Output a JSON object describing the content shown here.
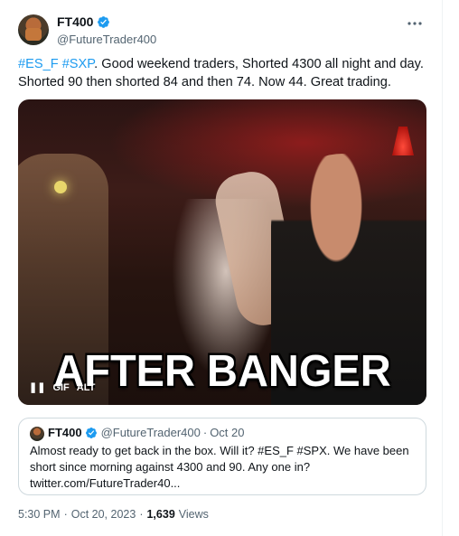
{
  "author": {
    "display_name": "FT400",
    "handle": "@FutureTrader400",
    "verified_icon": "verified-badge-icon"
  },
  "more_icon": "more-horizontal-icon",
  "tweet": {
    "hashtag_1": "#ES_F",
    "hashtag_2": "#SXP",
    "text_rest": ". Good weekend traders, Shorted 4300 all night and day. Shorted 90 then shorted 84 and then 74.  Now 44. Great trading."
  },
  "media": {
    "caption": "AFTER BANGER",
    "pause_icon": "pause-icon",
    "gif_label": "GIF",
    "alt_label": "ALT"
  },
  "quote": {
    "display_name": "FT400",
    "handle": "@FutureTrader400",
    "dot": "·",
    "time": "Oct 20",
    "text": "Almost ready to get back in the box. Will it? #ES_F #SPX. We have been short since morning against 4300 and 90.  Any one in? twitter.com/FutureTrader40..."
  },
  "meta": {
    "time": "5:30 PM",
    "date": "Oct 20, 2023",
    "views_count": "1,639",
    "views_label": "Views",
    "sep": "·"
  },
  "colors": {
    "accent": "#1d9bf0",
    "text": "#0f1419",
    "muted": "#536471",
    "border": "#cfd9de"
  }
}
